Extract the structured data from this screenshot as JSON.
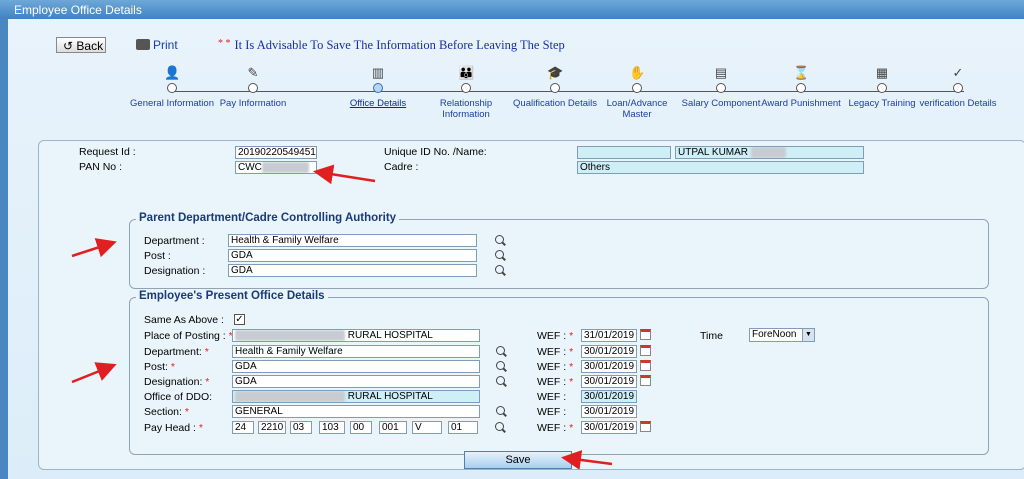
{
  "window": {
    "title": "Employee Office Details"
  },
  "toolbar": {
    "back_label": "Back",
    "print_label": "Print",
    "advisory": "It Is Advisable To Save The Information Before Leaving The Step",
    "advisory_stars": "* *"
  },
  "steps": [
    {
      "label": "General Information",
      "icon": "person-icon"
    },
    {
      "label": "Pay Information",
      "icon": "money-icon"
    },
    {
      "label": "Office Details",
      "icon": "building-icon",
      "active": true
    },
    {
      "label": "Relationship Information",
      "icon": "family-icon"
    },
    {
      "label": "Qualification Details",
      "icon": "graduation-cap-icon"
    },
    {
      "label": "Loan/Advance Master",
      "icon": "hand-money-icon"
    },
    {
      "label": "Salary Component",
      "icon": "calculator-icon"
    },
    {
      "label": "Award Punishment",
      "icon": "hourglass-icon"
    },
    {
      "label": "Legacy Training",
      "icon": "chart-icon"
    },
    {
      "label": "verification Details",
      "icon": "checkmark-icon"
    }
  ],
  "header_fields": {
    "request_id_label": "Request Id :",
    "request_id_value": "20190220549451",
    "pan_label": "PAN No :",
    "pan_value": "CWC",
    "unique_id_label": "Unique ID No. /Name:",
    "unique_name_value": "UTPAL KUMAR",
    "cadre_label": "Cadre :",
    "cadre_value": "Others"
  },
  "parent": {
    "legend": "Parent Department/Cadre Controlling Authority",
    "department_label": "Department :",
    "department_value": "Health & Family Welfare",
    "post_label": "Post :",
    "post_value": "GDA",
    "designation_label": "Designation :",
    "designation_value": "GDA"
  },
  "present": {
    "legend": "Employee's Present Office Details",
    "same_label": "Same As Above :",
    "same_checked": "✓",
    "posting_label": "Place of Posting :",
    "posting_value": "RURAL HOSPITAL",
    "department_label": "Department:",
    "department_value": "Health & Family Welfare",
    "post_label": "Post:",
    "post_value": "GDA",
    "designation_label": "Designation:",
    "designation_value": "GDA",
    "ddo_label": "Office of DDO:",
    "ddo_value": "RURAL HOSPITAL",
    "section_label": "Section:",
    "section_value": "GENERAL",
    "payhead_label": "Pay Head :",
    "payhead": [
      "24",
      "2210",
      "03",
      "103",
      "00",
      "001",
      "V",
      "01"
    ],
    "wef_label": "WEF :",
    "wef": [
      "31/01/2019",
      "30/01/2019",
      "30/01/2019",
      "30/01/2019",
      "30/01/2019",
      "30/01/2019",
      "30/01/2019"
    ],
    "time_label": "Time",
    "time_value": "ForeNoon"
  },
  "actions": {
    "save_label": "Save"
  },
  "colors": {
    "title_bar": "#3f82c4",
    "arrow": "#e02020",
    "link": "#1a3fa0"
  }
}
